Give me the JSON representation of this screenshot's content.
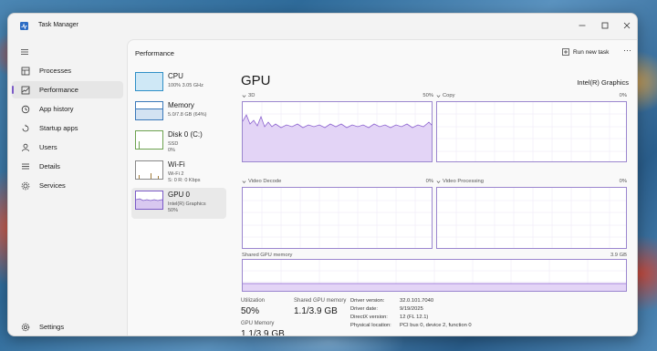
{
  "app": {
    "title": "Task Manager"
  },
  "window_controls": {
    "minimize": "—",
    "maximize": "☐",
    "close": "✕"
  },
  "nav": {
    "items": [
      {
        "label": "Processes",
        "icon": "processes-icon"
      },
      {
        "label": "Performance",
        "icon": "performance-icon",
        "active": true
      },
      {
        "label": "App history",
        "icon": "app-history-icon"
      },
      {
        "label": "Startup apps",
        "icon": "startup-apps-icon"
      },
      {
        "label": "Users",
        "icon": "users-icon"
      },
      {
        "label": "Details",
        "icon": "details-icon"
      },
      {
        "label": "Services",
        "icon": "services-icon"
      }
    ],
    "settings_label": "Settings"
  },
  "header": {
    "title": "Performance",
    "run_new_task": "Run new task",
    "more": "···"
  },
  "perf_items": [
    {
      "name": "CPU",
      "sub1": "100% 3.05 GHz",
      "sub2": ""
    },
    {
      "name": "Memory",
      "sub1": "5.0/7.8 GB (64%)",
      "sub2": ""
    },
    {
      "name": "Disk 0 (C:)",
      "sub1": "SSD",
      "sub2": "0%"
    },
    {
      "name": "Wi-Fi",
      "sub1": "Wi-Fi 2",
      "sub2": "S: 0 R: 0 Kbps"
    },
    {
      "name": "GPU 0",
      "sub1": "Intel(R) Graphics",
      "sub2": "50%"
    }
  ],
  "gpu": {
    "title": "GPU",
    "adapter": "Intel(R) Graphics",
    "graphs": {
      "g3d": {
        "label": "3D",
        "pct": "50%"
      },
      "copy": {
        "label": "Copy",
        "pct": "0%"
      },
      "video_decode": {
        "label": "Video Decode",
        "pct": "0%"
      },
      "video_processing": {
        "label": "Video Processing",
        "pct": "0%"
      },
      "shared": {
        "label": "Shared GPU memory",
        "max": "3.9 GB"
      }
    },
    "utilization_label": "Utilization",
    "utilization_value": "50%",
    "shared_mem_label": "Shared GPU memory",
    "shared_mem_value": "1.1/3.9 GB",
    "gpu_mem_label": "GPU Memory",
    "gpu_mem_value": "1.1/3.9 GB",
    "details": [
      {
        "key": "Driver version:",
        "value": "32.0.101.7040"
      },
      {
        "key": "Driver date:",
        "value": "9/19/2025"
      },
      {
        "key": "DirectX version:",
        "value": "12 (FL 12.1)"
      },
      {
        "key": "Physical location:",
        "value": "PCI bus 0, device 2, function 0"
      }
    ]
  },
  "colors": {
    "accent": "#7b5ac7",
    "graph_fill": "#e6d9f7",
    "graph_line": "#9b6fd3"
  }
}
